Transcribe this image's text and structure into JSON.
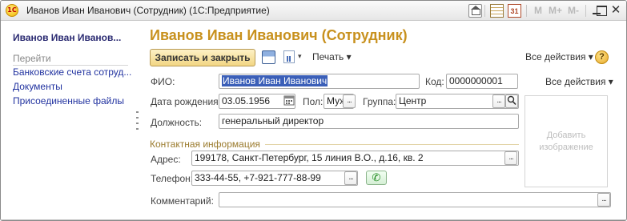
{
  "window": {
    "title": "Иванов Иван Иванович (Сотрудник)  (1С:Предприятие)",
    "logo_text": "1С",
    "calendar_day": "31",
    "memory_buttons": [
      "M",
      "M+",
      "M-"
    ],
    "close_glyph": "✕"
  },
  "left_panel": {
    "title": "Иванов Иван Иванов...",
    "nav_header": "Перейти",
    "links": [
      "Банковские счета сотруд...",
      "Документы",
      "Присоединенные файлы"
    ]
  },
  "form": {
    "title": "Иванов Иван Иванович (Сотрудник)",
    "toolbar": {
      "save_close_label": "Записать и закрыть",
      "print_label": "Печать ▾",
      "all_actions_label": "Все действия ▾",
      "help_label": "?",
      "report_arrow": "▾"
    },
    "all_actions_right": "Все действия ▾",
    "fields": {
      "fio_label": "ФИО:",
      "fio_value": "Иванов Иван Иванович",
      "code_label": "Код:",
      "code_value": "0000000001",
      "birth_label": "Дата рождения:",
      "birth_value": "03.05.1956",
      "gender_label": "Пол:",
      "gender_value": "Муж",
      "group_label": "Группа:",
      "group_value": "Центр",
      "position_label": "Должность:",
      "position_value": "генеральный директор",
      "address_label": "Адрес:",
      "address_value": "199178, Санкт-Петербург, 15 линия В.О., д.16, кв. 2",
      "phone_label": "Телефон:",
      "phone_value": "333-44-55, +7-921-777-88-99",
      "comment_label": "Комментарий:",
      "comment_value": ""
    },
    "contact_section_title": "Контактная информация",
    "image_placeholder": "Добавить изображение",
    "ellipsis": "...",
    "search_glyph": "⚲",
    "phone_glyph": "✆"
  }
}
